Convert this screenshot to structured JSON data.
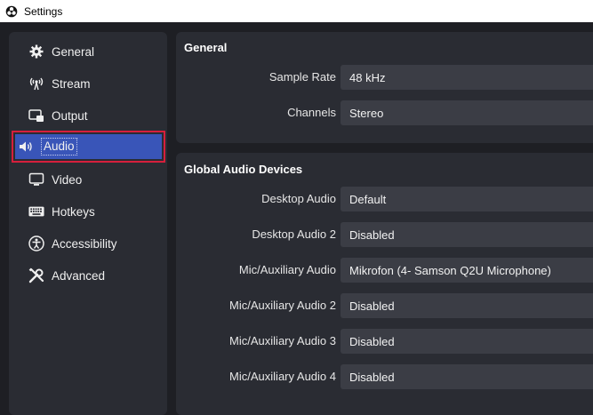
{
  "window": {
    "title": "Settings"
  },
  "sidebar": {
    "items": [
      {
        "label": "General",
        "icon": "gear-icon"
      },
      {
        "label": "Stream",
        "icon": "antenna-icon"
      },
      {
        "label": "Output",
        "icon": "output-icon"
      },
      {
        "label": "Audio",
        "icon": "speaker-icon",
        "active": true
      },
      {
        "label": "Video",
        "icon": "monitor-icon"
      },
      {
        "label": "Hotkeys",
        "icon": "keyboard-icon"
      },
      {
        "label": "Accessibility",
        "icon": "accessibility-icon"
      },
      {
        "label": "Advanced",
        "icon": "tools-icon"
      }
    ]
  },
  "general": {
    "title": "General",
    "rows": [
      {
        "label": "Sample Rate",
        "value": "48 kHz"
      },
      {
        "label": "Channels",
        "value": "Stereo"
      }
    ]
  },
  "devices": {
    "title": "Global Audio Devices",
    "rows": [
      {
        "label": "Desktop Audio",
        "value": "Default"
      },
      {
        "label": "Desktop Audio 2",
        "value": "Disabled"
      },
      {
        "label": "Mic/Auxiliary Audio",
        "value": "Mikrofon (4- Samson Q2U Microphone)"
      },
      {
        "label": "Mic/Auxiliary Audio 2",
        "value": "Disabled"
      },
      {
        "label": "Mic/Auxiliary Audio 3",
        "value": "Disabled"
      },
      {
        "label": "Mic/Auxiliary Audio 4",
        "value": "Disabled"
      }
    ]
  },
  "colors": {
    "active_item": "#3955b8",
    "highlight_border": "#d61f3c",
    "panel_bg": "#2a2c33",
    "window_bg": "#1e1f24",
    "field_bg": "#3b3d45"
  }
}
